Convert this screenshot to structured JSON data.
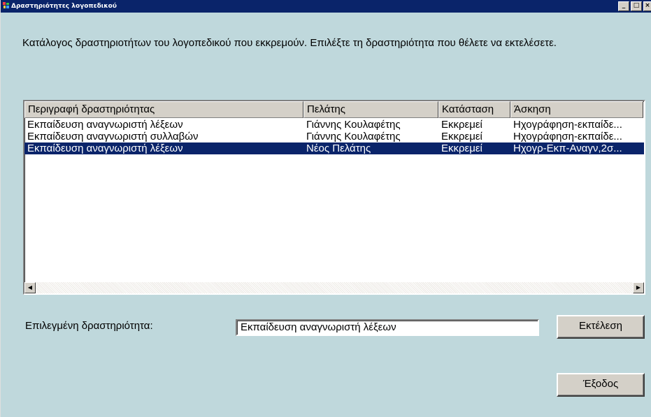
{
  "window": {
    "title": "Δραστηριότητες λογοπεδικού",
    "controls": {
      "minimize": "_",
      "maximize": "□",
      "close": "×"
    }
  },
  "instruction": "Κατάλογος δραστηριοτήτων του λογοπεδικού που εκκρεμούν. Επιλέξτε τη δραστηριότητα που θέλετε να εκτελέσετε.",
  "list": {
    "columns": [
      "Περιγραφή δραστηριότητας",
      "Πελάτης",
      "Κατάσταση",
      "Άσκηση"
    ],
    "rows": [
      [
        "Εκπαίδευση αναγνωριστή λέξεων",
        "Γιάννης Κουλαφέτης",
        "Εκκρεμεί",
        "Ηχογράφηση-εκπαίδε..."
      ],
      [
        "Εκπαίδευση αναγνωριστή συλλαβών",
        "Γιάννης Κουλαφέτης",
        "Εκκρεμεί",
        "Ηχογράφηση-εκπαίδε..."
      ],
      [
        "Εκπαίδευση αναγνωριστή λέξεων",
        "Νέος Πελάτης",
        "Εκκρεμεί",
        "Ηχογρ-Εκπ-Αναγν,2σ..."
      ]
    ],
    "selected_row": 2
  },
  "selected": {
    "label": "Επιλεγμένη δραστηριότητα:",
    "value": "Εκπαίδευση αναγνωριστή λέξεων"
  },
  "buttons": {
    "run": "Εκτέλεση",
    "exit": "Έξοδος"
  },
  "colors": {
    "window_bg": "#bfd8dc",
    "titlebar": "#0a246a",
    "selection": "#0a246a"
  }
}
